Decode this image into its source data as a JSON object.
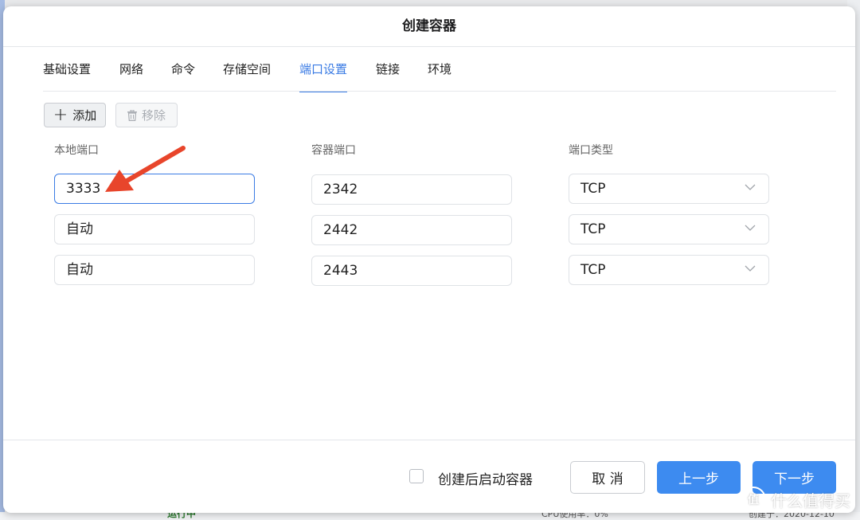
{
  "dialog": {
    "title": "创建容器"
  },
  "tabs": [
    {
      "label": "基础设置"
    },
    {
      "label": "网络"
    },
    {
      "label": "命令"
    },
    {
      "label": "存储空间"
    },
    {
      "label": "端口设置",
      "active": true
    },
    {
      "label": "链接"
    },
    {
      "label": "环境"
    }
  ],
  "toolbar": {
    "add_label": "添加",
    "remove_label": "移除"
  },
  "columns": {
    "local_port": "本地端口",
    "container_port": "容器端口",
    "port_type": "端口类型"
  },
  "rows": [
    {
      "local": "3333",
      "container": "2342",
      "type": "TCP"
    },
    {
      "local": "自动",
      "container": "2442",
      "type": "TCP"
    },
    {
      "local": "自动",
      "container": "2443",
      "type": "TCP"
    }
  ],
  "footer": {
    "checkbox_label": "创建后启动容器",
    "checkbox_checked": false,
    "cancel_label": "取 消",
    "prev_label": "上一步",
    "next_label": "下一步"
  },
  "colors": {
    "accent": "#3a7be4",
    "primary_button": "#3d8bf0",
    "annotation_arrow": "#e8452b"
  },
  "watermark": {
    "text": "什么值得买",
    "logo_char": "值"
  },
  "background": {
    "text_1": "运行中",
    "text_2": "CPU使用率：0%",
    "text_3": "创建于：2020-12-10"
  }
}
